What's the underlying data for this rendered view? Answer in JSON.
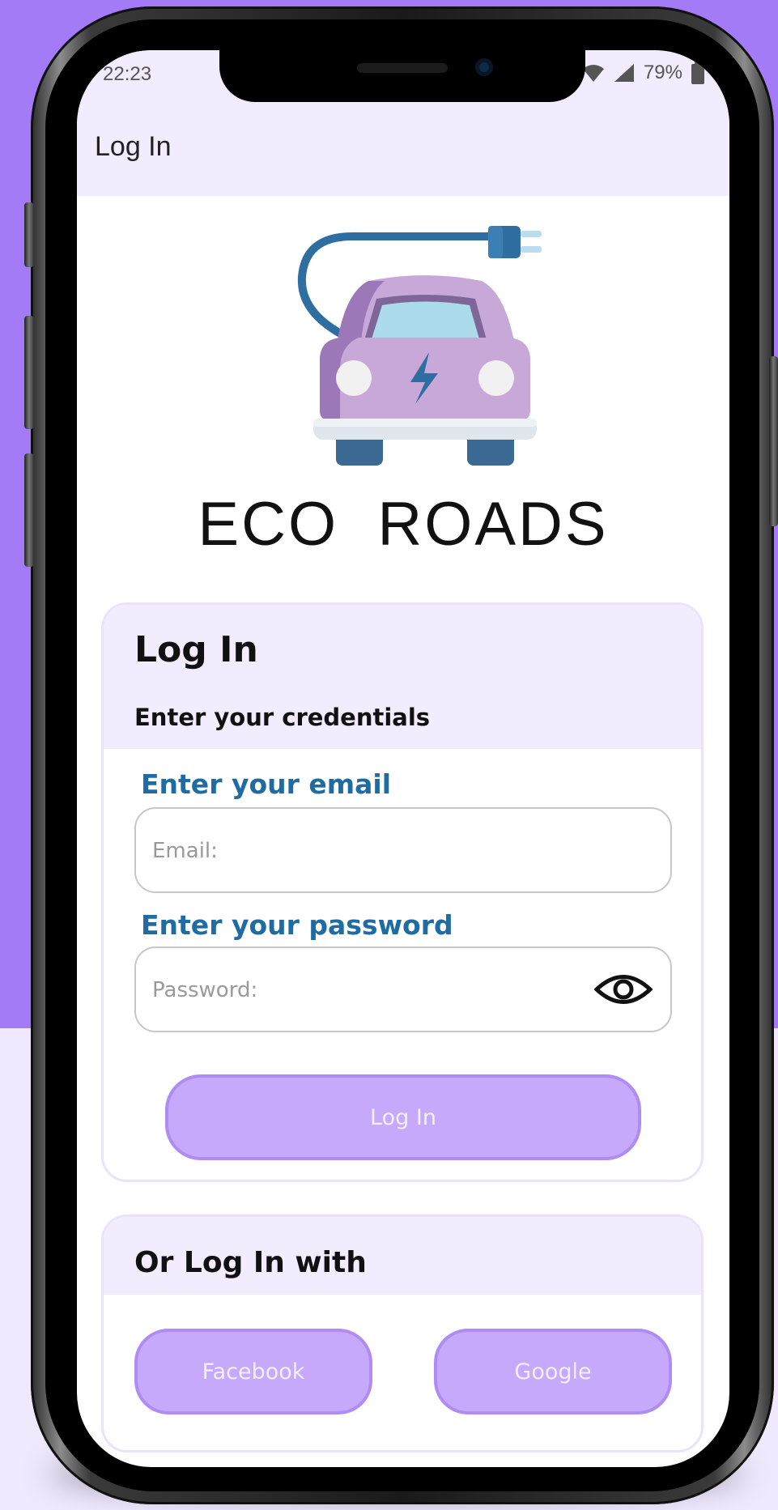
{
  "colors": {
    "outer_bg_top": "#a47bf7",
    "outer_bg_bottom": "#f0e9fe",
    "header_tint": "#f3ecfe",
    "label_blue": "#1f6ca3",
    "button_fill": "#c6a9fa",
    "button_border": "#ae8cf3"
  },
  "status_bar": {
    "time": "22:23",
    "battery": "79%",
    "icons": [
      "wifi-icon",
      "signal-icon",
      "battery-icon"
    ]
  },
  "app_bar": {
    "title": "Log In"
  },
  "logo": {
    "brand": "ECO  ROADS",
    "icon": "electric-car-logo-icon"
  },
  "login_card": {
    "title": "Log In",
    "subtitle": "Enter your credentials",
    "email": {
      "label": "Enter your email",
      "placeholder": "Email:",
      "value": ""
    },
    "password": {
      "label": "Enter your password",
      "placeholder": "Password:",
      "value": "",
      "toggle_icon": "eye-icon"
    },
    "submit_label": "Log In"
  },
  "social_card": {
    "title": "Or Log In with",
    "facebook_label": "Facebook",
    "google_label": "Google"
  }
}
